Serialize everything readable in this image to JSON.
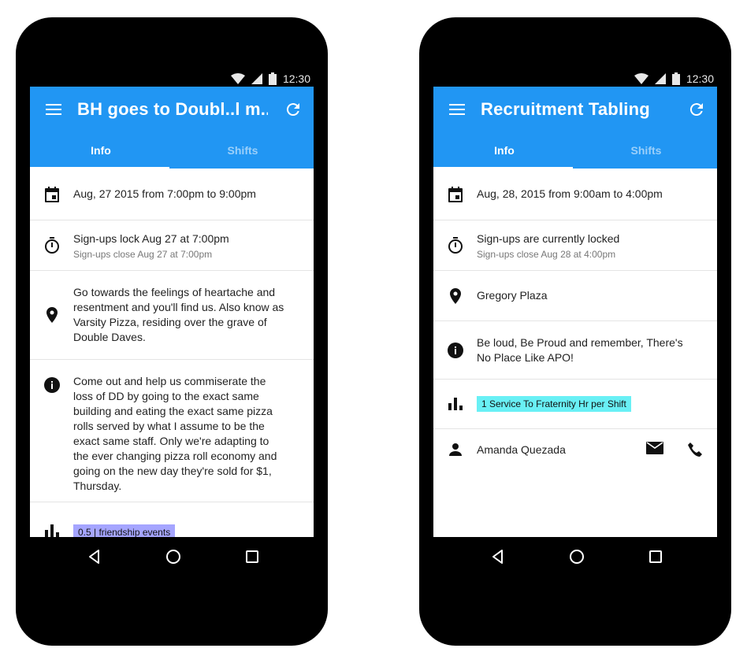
{
  "status": {
    "time": "12:30"
  },
  "left": {
    "title": "BH goes to Doubl..l m..",
    "tabs": [
      "Info",
      "Shifts"
    ],
    "datetime": "Aug, 27 2015 from 7:00pm to 9:00pm",
    "signup_lock": "Sign-ups lock Aug 27 at 7:00pm",
    "signup_close": "Sign-ups close Aug 27 at 7:00pm",
    "location": "Go towards the feelings of heartache and resentment and you'll find us. Also know as Varsity Pizza, residing over the grave of Double Daves.",
    "description": "Come out and help us commiserate the loss of DD by going to the exact same building and eating the exact same pizza rolls served by what I assume to be the exact same staff. Only we're adapting to the ever changing pizza roll economy and going on the new day they're sold for $1, Thursday.",
    "credit": "0.5 | friendship events",
    "credit_color": "#a5a5ff"
  },
  "right": {
    "title": "Recruitment Tabling",
    "tabs": [
      "Info",
      "Shifts"
    ],
    "datetime": "Aug, 28, 2015 from 9:00am to 4:00pm",
    "signup_lock": "Sign-ups are currently locked",
    "signup_close": "Sign-ups close Aug 28 at 4:00pm",
    "location": "Gregory Plaza",
    "description": "Be loud, Be Proud and remember, There's No Place Like APO!",
    "credit": "1 Service To Fraternity Hr per Shift",
    "credit_color": "#69f0f5",
    "contact": "Amanda Quezada"
  },
  "colors": {
    "appbar": "#2196f3"
  },
  "icons": {
    "menu": "menu-icon",
    "refresh": "refresh-icon",
    "calendar": "calendar-icon",
    "timer": "timer-icon",
    "location": "location-icon",
    "info": "info-icon",
    "chart": "bar-chart-icon",
    "person": "person-icon",
    "email": "email-icon",
    "phone": "phone-icon"
  }
}
